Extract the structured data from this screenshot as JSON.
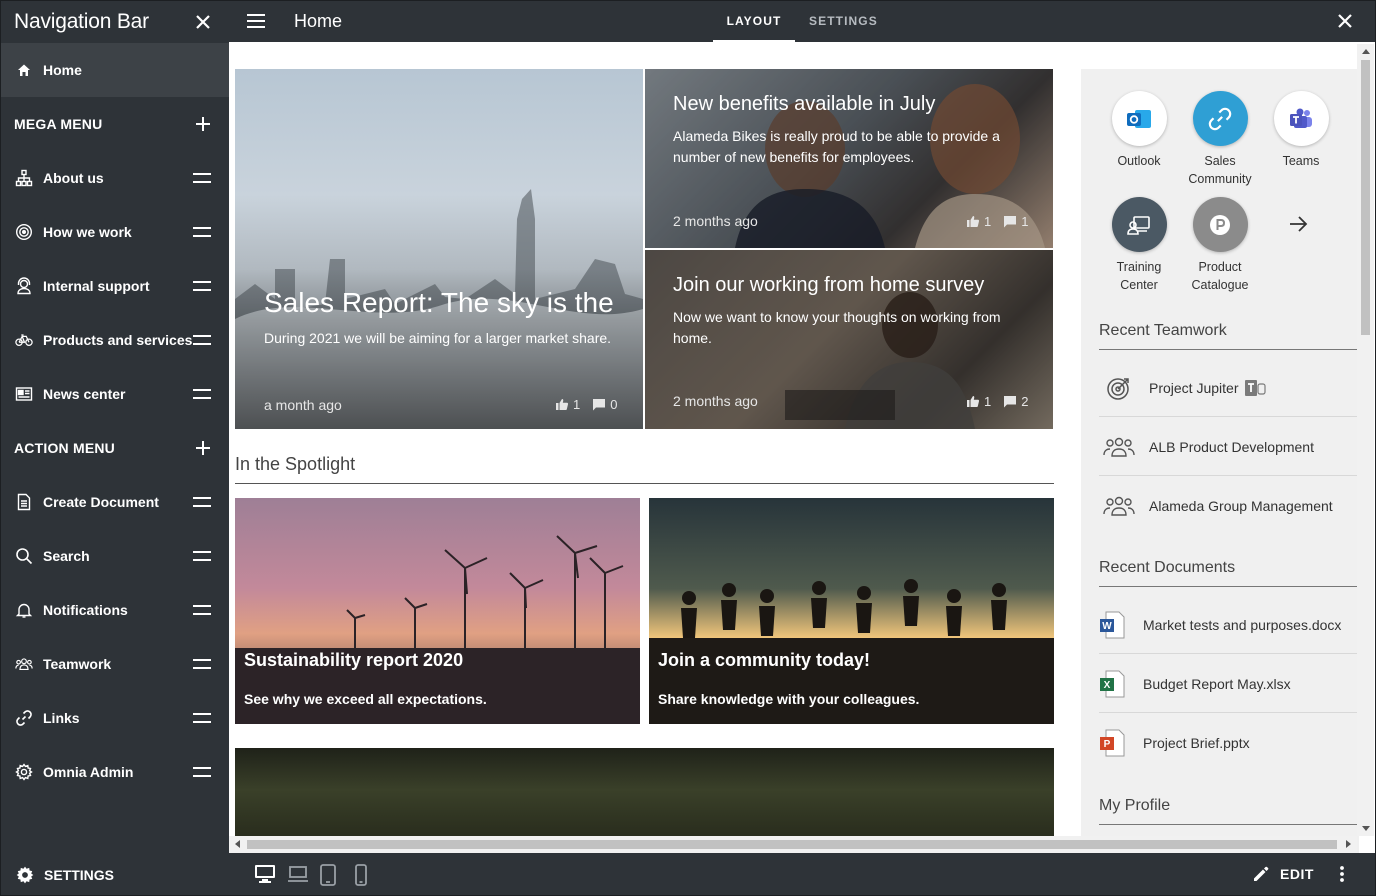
{
  "sidebar": {
    "title": "Navigation Bar",
    "home": "Home",
    "mega_menu": "MEGA MENU",
    "mega_items": [
      "About us",
      "How we work",
      "Internal support",
      "Products and services",
      "News center"
    ],
    "action_menu": "ACTION MENU",
    "action_items": [
      "Create Document",
      "Search",
      "Notifications",
      "Teamwork",
      "Links",
      "Omnia Admin"
    ]
  },
  "topbar": {
    "page_title": "Home",
    "tabs": [
      "LAYOUT",
      "SETTINGS"
    ],
    "active_tab": "LAYOUT"
  },
  "news": [
    {
      "title": "Sales Report: The sky is the",
      "summary": "During 2021 we will be aiming for a larger market share.",
      "ago": "a month ago",
      "likes": "1",
      "comments": "0"
    },
    {
      "title": "New benefits available in July",
      "summary": "Alameda Bikes is really proud to be able to provide a number of new benefits for employees.",
      "ago": "2 months ago",
      "likes": "1",
      "comments": "1"
    },
    {
      "title": "Join our working from home survey",
      "summary": "Now we want to know your thoughts on working from home.",
      "ago": "2 months ago",
      "likes": "1",
      "comments": "2"
    }
  ],
  "spotlight": {
    "heading": "In the Spotlight",
    "cards": [
      {
        "title": "Sustainability report 2020",
        "text": "See why we exceed all expectations."
      },
      {
        "title": "Join a community today!",
        "text": "Share knowledge with your colleagues."
      }
    ]
  },
  "apps": [
    {
      "label": "Outlook",
      "icon": "outlook-icon",
      "color": "#ffffff"
    },
    {
      "label": "Sales Community",
      "icon": "link-icon",
      "color": "#2f9fd4"
    },
    {
      "label": "Teams",
      "icon": "teams-icon",
      "color": "#ffffff"
    },
    {
      "label": "Training Center",
      "icon": "training-icon",
      "color": "#4b5964"
    },
    {
      "label": "Product Catalogue",
      "icon": "product-icon",
      "color": "#8b8b8b"
    }
  ],
  "recent_teamwork": {
    "heading": "Recent Teamwork",
    "items": [
      "Project Jupiter",
      "ALB Product Development",
      "Alameda Group Management"
    ]
  },
  "recent_documents": {
    "heading": "Recent Documents",
    "items": [
      {
        "name": "Market tests and purposes.docx",
        "type": "word",
        "color": "#2b579a"
      },
      {
        "name": "Budget Report May.xlsx",
        "type": "excel",
        "color": "#217346"
      },
      {
        "name": "Project Brief.pptx",
        "type": "powerpoint",
        "color": "#d24726"
      }
    ]
  },
  "my_profile": "My Profile",
  "bottombar": {
    "settings": "SETTINGS",
    "edit": "EDIT"
  },
  "colors": {
    "bar": "#2e3338",
    "active_row": "#3d4247"
  }
}
